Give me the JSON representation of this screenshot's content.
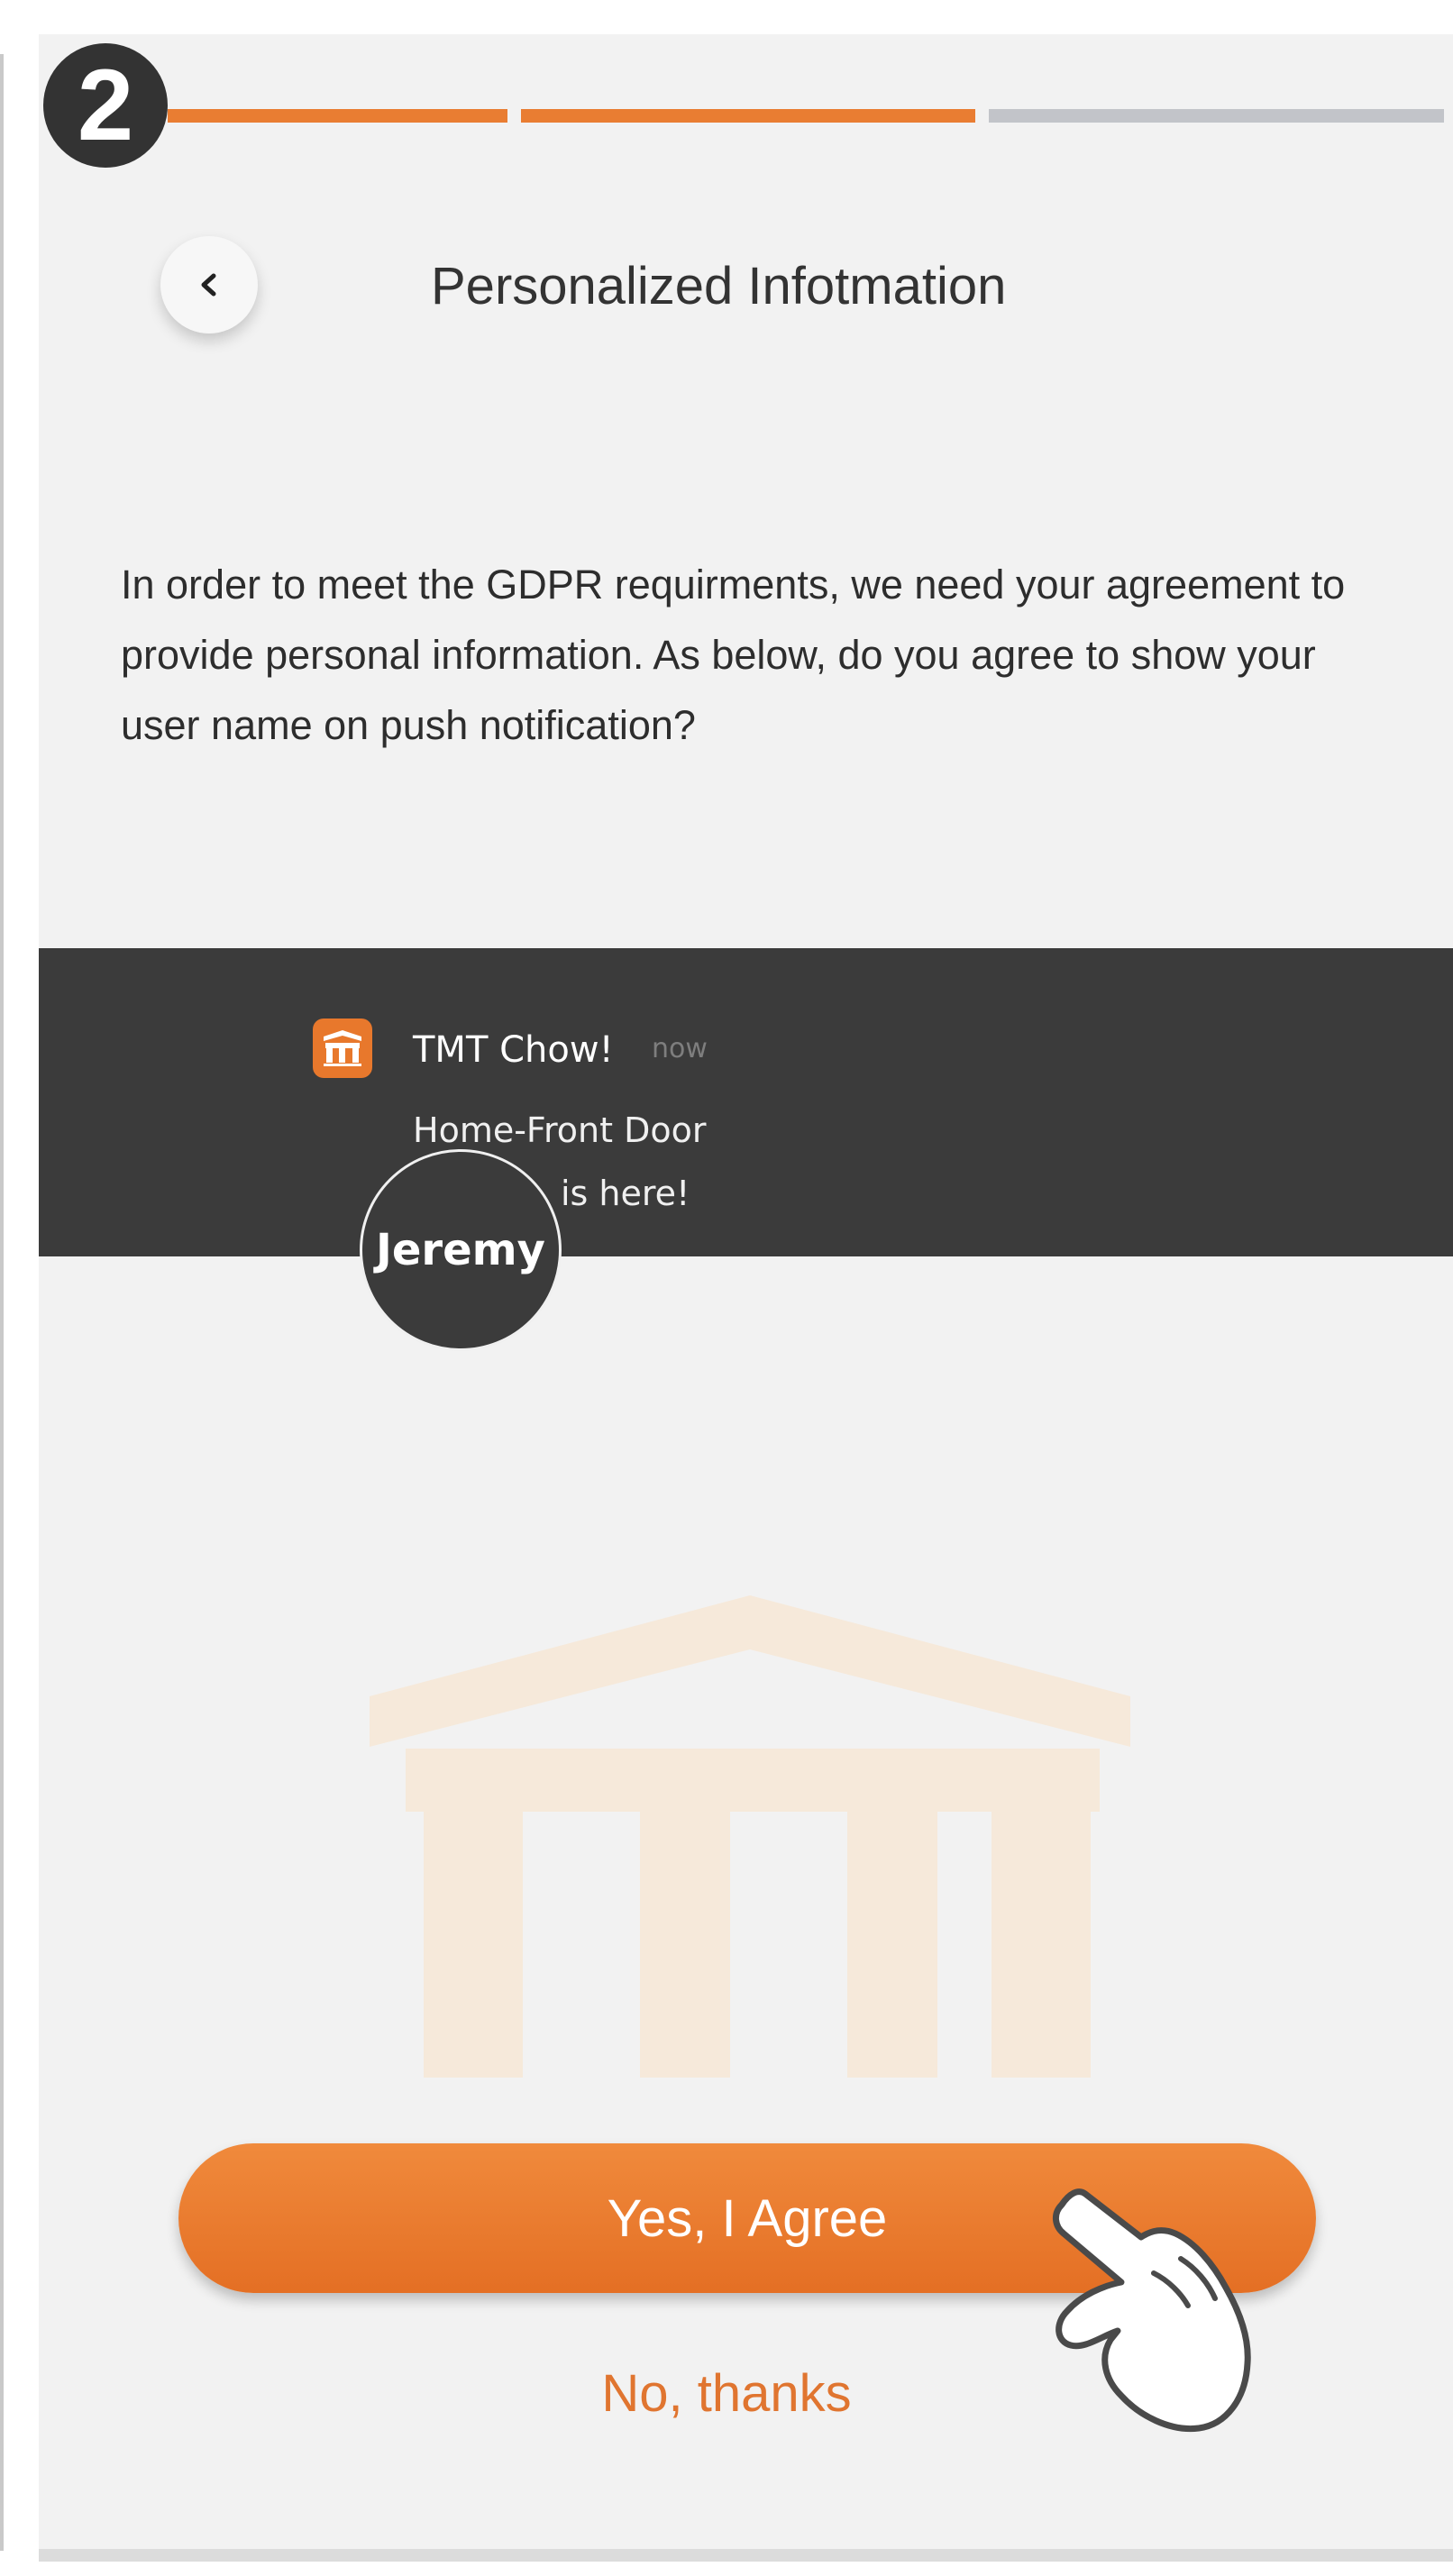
{
  "step": {
    "number": "2"
  },
  "progress": {
    "segments": [
      {
        "state": "complete",
        "color": "#e97d32"
      },
      {
        "state": "complete",
        "color": "#e97d32"
      },
      {
        "state": "pending",
        "color": "#c2c4c9"
      }
    ]
  },
  "header": {
    "back_icon": "chevron-left-icon",
    "title": "Personalized Infotmation"
  },
  "description": "In order to meet the GDPR requirments, we need your agreement to provide personal information. As below, do you agree to show your user name on push notification?",
  "notification": {
    "app_icon": "tmt-app-icon",
    "app_name": "TMT Chow!",
    "time": "now",
    "line1": "Home-Front Door",
    "line2": "is here!",
    "user_name": "Jeremy"
  },
  "actions": {
    "agree_label": "Yes, I Agree",
    "decline_label": "No, thanks"
  },
  "colors": {
    "accent": "#e97d32",
    "notification_bg": "#3b3b3b",
    "screen_bg": "#f2f2f2"
  }
}
